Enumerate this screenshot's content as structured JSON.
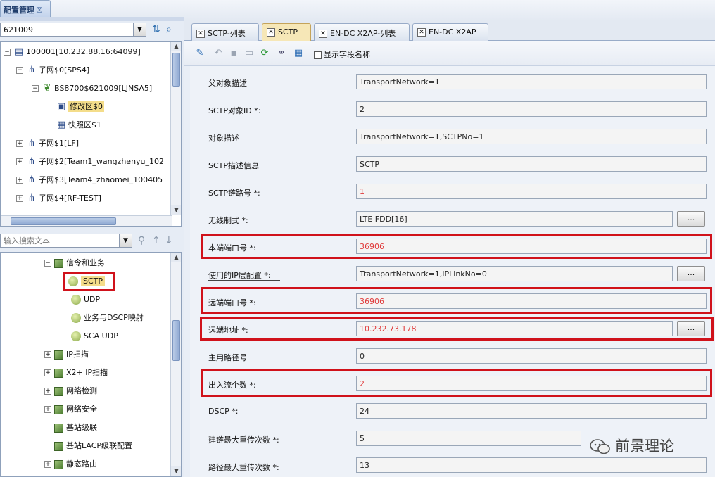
{
  "left_tab": {
    "title": "配置管理",
    "close": "☒"
  },
  "ne_combo": {
    "value": "621009"
  },
  "tree": {
    "rows": [
      {
        "label": "100001[10.232.88.16:64099]"
      },
      {
        "label": "子网$0[SPS4]"
      },
      {
        "label": "BS8700$621009[LJNSA5]"
      },
      {
        "label": "修改区$0"
      },
      {
        "label": "快照区$1"
      },
      {
        "label": "子网$1[LF]"
      },
      {
        "label": "子网$2[Team1_wangzhenyu_102"
      },
      {
        "label": "子网$3[Team4_zhaomei_100405"
      },
      {
        "label": "子网$4[RF-TEST]"
      }
    ]
  },
  "search": {
    "placeholder": "输入搜索文本"
  },
  "tree2": {
    "rows": [
      {
        "label": "信令和业务"
      },
      {
        "label": "SCTP"
      },
      {
        "label": "UDP"
      },
      {
        "label": "业务与DSCP映射"
      },
      {
        "label": "SCA UDP"
      },
      {
        "label": "IP扫描"
      },
      {
        "label": "X2+ IP扫描"
      },
      {
        "label": "网络检测"
      },
      {
        "label": "网络安全"
      },
      {
        "label": "基站级联"
      },
      {
        "label": "基站LACP级联配置"
      },
      {
        "label": "静态路由"
      }
    ]
  },
  "tabs": [
    {
      "label": "SCTP-列表"
    },
    {
      "label": "SCTP"
    },
    {
      "label": "EN-DC X2AP-列表"
    },
    {
      "label": "EN-DC X2AP"
    }
  ],
  "toolbar": {
    "show_field_name": "显示字段名称"
  },
  "form": {
    "fields": [
      {
        "label": "父对象描述",
        "value": "TransportNetwork=1"
      },
      {
        "label": "SCTP对象ID *:",
        "value": "2"
      },
      {
        "label": "对象描述",
        "value": "TransportNetwork=1,SCTPNo=1"
      },
      {
        "label": "SCTP描述信息",
        "value": "SCTP"
      },
      {
        "label": "SCTP链路号 *:",
        "value": "1"
      },
      {
        "label": "无线制式 *:",
        "value": "LTE FDD[16]"
      },
      {
        "label": "本端端口号 *:",
        "value": "36906"
      },
      {
        "label": "使用的IP层配置 *:",
        "value": "TransportNetwork=1,IPLinkNo=0"
      },
      {
        "label": "远端端口号 *:",
        "value": "36906"
      },
      {
        "label": "远端地址 *:",
        "value": "10.232.73.178"
      },
      {
        "label": "主用路径号",
        "value": "0"
      },
      {
        "label": "出入流个数 *:",
        "value": "2"
      },
      {
        "label": "DSCP *:",
        "value": "24"
      },
      {
        "label": "建链最大重传次数 *:",
        "value": "5"
      },
      {
        "label": "路径最大重传次数 *:",
        "value": "13"
      }
    ],
    "dots_label": "..."
  },
  "watermark": {
    "text": "前景理论"
  },
  "colors": {
    "highlight": "#d0121b",
    "red_value": "#e03a3a",
    "active_tab": "#f6e7b7"
  }
}
